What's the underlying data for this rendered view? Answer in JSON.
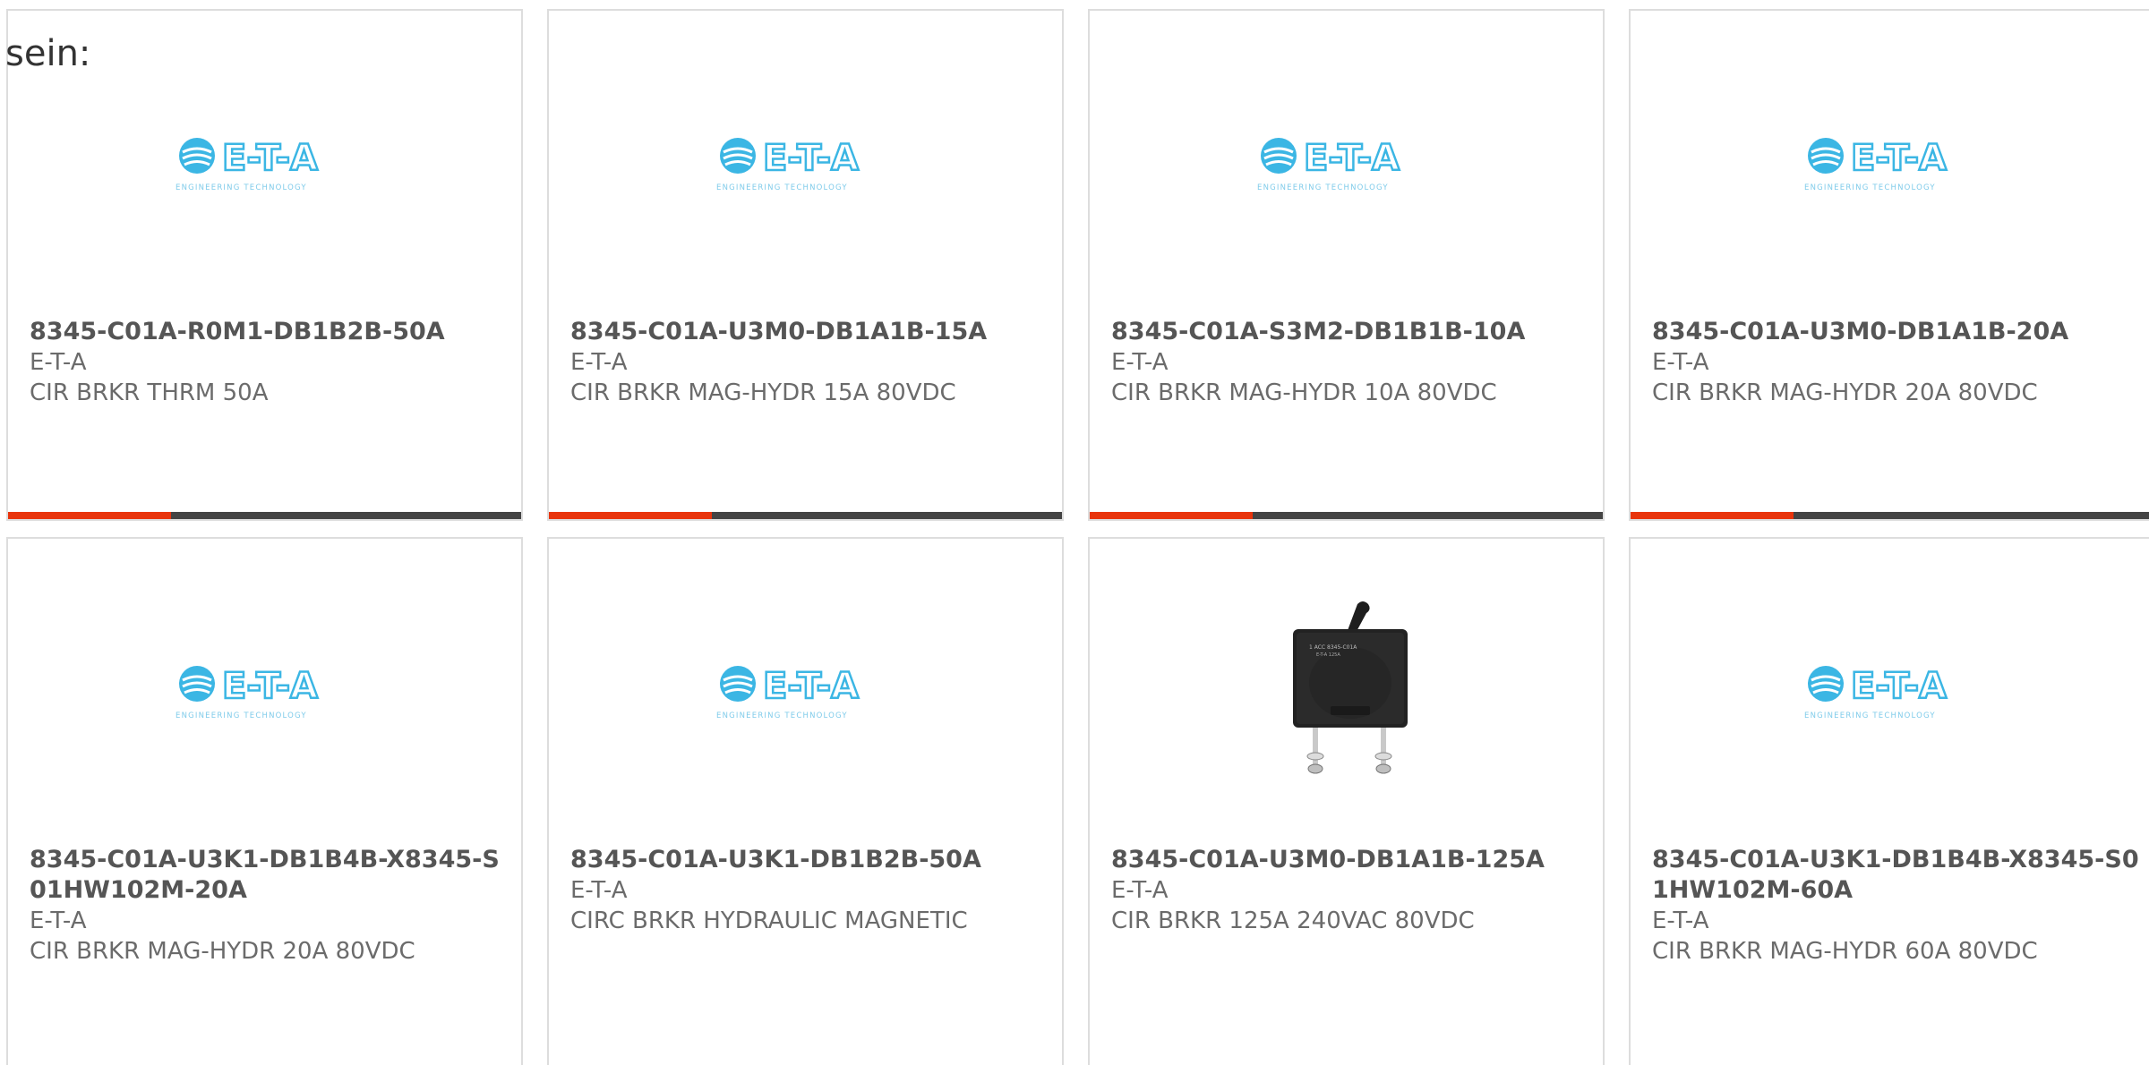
{
  "lead_text": "sein:",
  "colors": {
    "accent": "#e8340c",
    "bar": "#444444",
    "logo_blue": "#3bb6e4",
    "card_border": "#dddddd"
  },
  "products": [
    {
      "part_number": "8345-C01A-R0M1-DB1B2B-50A",
      "manufacturer": "E-T-A",
      "description": "CIR BRKR THRM 50A",
      "image": "eta-logo",
      "logo_text": "E-T-A",
      "logo_tagline": "ENGINEERING TECHNOLOGY"
    },
    {
      "part_number": "8345-C01A-U3M0-DB1A1B-15A",
      "manufacturer": "E-T-A",
      "description": "CIR BRKR MAG-HYDR 15A 80VDC",
      "image": "eta-logo",
      "logo_text": "E-T-A",
      "logo_tagline": "ENGINEERING TECHNOLOGY"
    },
    {
      "part_number": "8345-C01A-S3M2-DB1B1B-10A",
      "manufacturer": "E-T-A",
      "description": "CIR BRKR MAG-HYDR 10A 80VDC",
      "image": "eta-logo",
      "logo_text": "E-T-A",
      "logo_tagline": "ENGINEERING TECHNOLOGY"
    },
    {
      "part_number": "8345-C01A-U3M0-DB1A1B-20A",
      "manufacturer": "E-T-A",
      "description": "CIR BRKR MAG-HYDR 20A 80VDC",
      "image": "eta-logo",
      "logo_text": "E-T-A",
      "logo_tagline": "ENGINEERING TECHNOLOGY"
    },
    {
      "part_number": "8345-C01A-U3K1-DB1B4B-X8345-S01HW102M-20A",
      "manufacturer": "E-T-A",
      "description": "CIR BRKR MAG-HYDR 20A 80VDC",
      "image": "eta-logo",
      "logo_text": "E-T-A",
      "logo_tagline": "ENGINEERING TECHNOLOGY"
    },
    {
      "part_number": "8345-C01A-U3K1-DB1B2B-50A",
      "manufacturer": "E-T-A",
      "description": "CIRC BRKR HYDRAULIC MAGNETIC",
      "image": "eta-logo",
      "logo_text": "E-T-A",
      "logo_tagline": "ENGINEERING TECHNOLOGY"
    },
    {
      "part_number": "8345-C01A-U3M0-DB1A1B-125A",
      "manufacturer": "E-T-A",
      "description": "CIR BRKR 125A 240VAC 80VDC",
      "image": "circuit-breaker-photo"
    },
    {
      "part_number": "8345-C01A-U3K1-DB1B4B-X8345-S01HW102M-60A",
      "manufacturer": "E-T-A",
      "description": "CIR BRKR MAG-HYDR 60A 80VDC",
      "image": "eta-logo",
      "logo_text": "E-T-A",
      "logo_tagline": "ENGINEERING TECHNOLOGY"
    }
  ]
}
